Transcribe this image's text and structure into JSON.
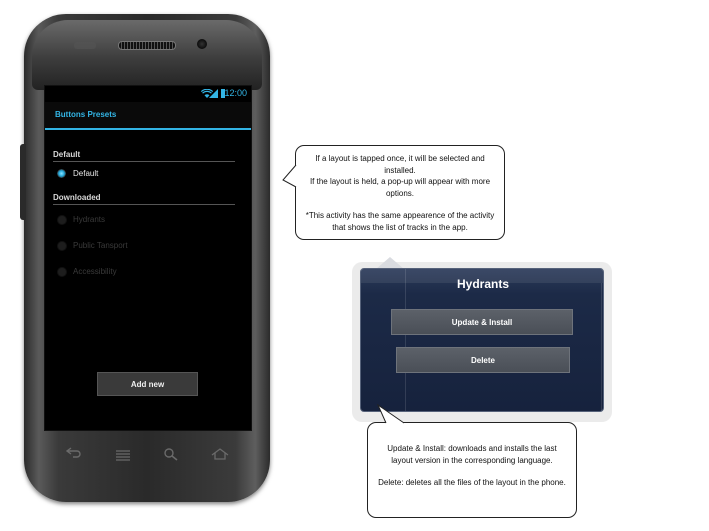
{
  "statusbar": {
    "time": "12:00"
  },
  "app": {
    "title": "Buttons Presets"
  },
  "sections": {
    "default": {
      "header": "Default",
      "items": [
        {
          "label": "Default",
          "selected": true
        }
      ]
    },
    "downloaded": {
      "header": "Downloaded",
      "items": [
        {
          "label": "Hydrants",
          "selected": false
        },
        {
          "label": "Public Tansport",
          "selected": false
        },
        {
          "label": "Accessibility",
          "selected": false
        }
      ]
    }
  },
  "actions": {
    "add_new": "Add new"
  },
  "callout_top": {
    "line1": "If a layout is tapped once, it will be selected and installed.",
    "line2": "If the layout is held, a pop-up will appear with more options.",
    "line3": "*This activity has the same appearence of the activity that shows the list of tracks in the app."
  },
  "dialog": {
    "title": "Hydrants",
    "update_label": "Update & Install",
    "delete_label": "Delete"
  },
  "callout_bottom": {
    "line1": "Update & Install: downloads and installs the last layout version in the corresponding language.",
    "line2": "Delete: deletes all the files of the layout in the phone."
  },
  "colors": {
    "accent": "#33b5e5",
    "screen_bg": "#000000",
    "dialog_bg": "#1c2a47"
  },
  "icons": [
    "wifi-icon",
    "signal-icon",
    "battery-icon",
    "back-icon",
    "menu-icon",
    "search-icon",
    "home-icon"
  ]
}
